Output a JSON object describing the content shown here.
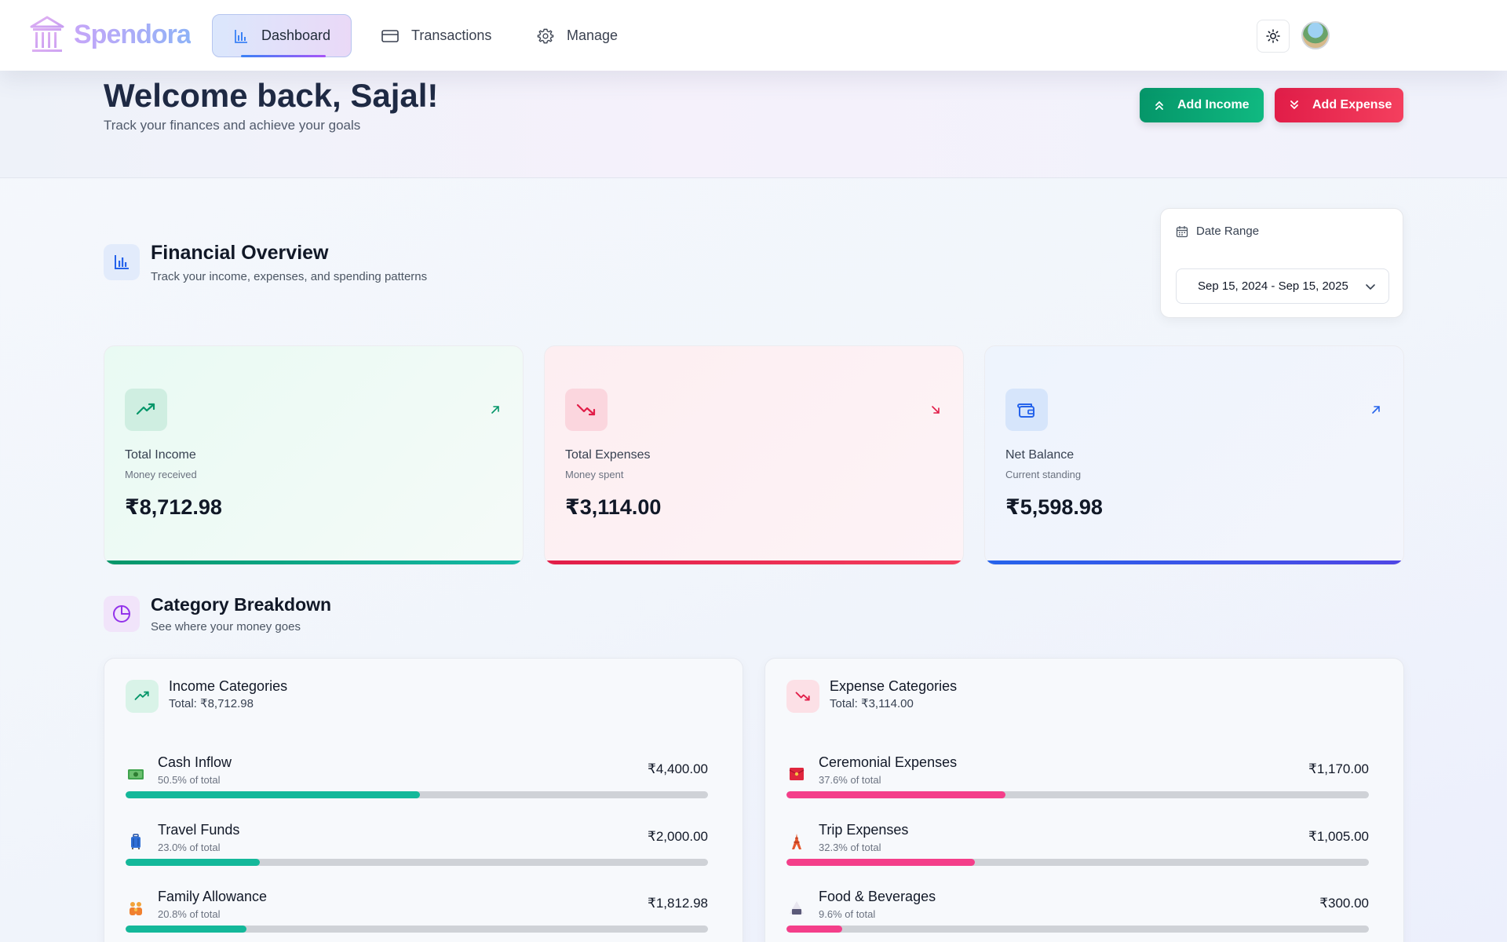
{
  "app": {
    "name": "Spendora"
  },
  "nav": {
    "items": [
      {
        "label": "Dashboard",
        "icon": "bar-chart-icon",
        "active": true
      },
      {
        "label": "Transactions",
        "icon": "credit-card-icon",
        "active": false
      },
      {
        "label": "Manage",
        "icon": "gear-icon",
        "active": false
      }
    ]
  },
  "hero": {
    "welcome": "Welcome back, Sajal!",
    "subtitle": "Track your finances and achieve your goals",
    "add_income": "Add Income",
    "add_expense": "Add Expense"
  },
  "overview": {
    "title": "Financial Overview",
    "subtitle": "Track your income, expenses, and spending patterns",
    "date_range_label": "Date Range",
    "date_range_value": "Sep 15, 2024 - Sep 15, 2025"
  },
  "stats": {
    "income": {
      "label": "Total Income",
      "sub": "Money received",
      "value": "₹8,712.98"
    },
    "expenses": {
      "label": "Total Expenses",
      "sub": "Money spent",
      "value": "₹3,114.00"
    },
    "balance": {
      "label": "Net Balance",
      "sub": "Current standing",
      "value": "₹5,598.98"
    }
  },
  "breakdown": {
    "title": "Category Breakdown",
    "subtitle": "See where your money goes",
    "income": {
      "title": "Income Categories",
      "total": "Total: ₹8,712.98",
      "items": [
        {
          "name": "Cash Inflow",
          "pct": "50.5% of total",
          "amount": "₹4,400.00",
          "fraction": 0.505,
          "icon": "dollar-banknote-icon"
        },
        {
          "name": "Travel Funds",
          "pct": "23.0% of total",
          "amount": "₹2,000.00",
          "fraction": 0.23,
          "icon": "suitcase-icon"
        },
        {
          "name": "Family Allowance",
          "pct": "20.8% of total",
          "amount": "₹1,812.98",
          "fraction": 0.208,
          "icon": "family-icon"
        }
      ]
    },
    "expense": {
      "title": "Expense Categories",
      "total": "Total: ₹3,114.00",
      "items": [
        {
          "name": "Ceremonial Expenses",
          "pct": "37.6% of total",
          "amount": "₹1,170.00",
          "fraction": 0.376,
          "icon": "red-envelope-icon"
        },
        {
          "name": "Trip Expenses",
          "pct": "32.3% of total",
          "amount": "₹1,005.00",
          "fraction": 0.323,
          "icon": "tower-icon"
        },
        {
          "name": "Food & Beverages",
          "pct": "9.6% of total",
          "amount": "₹300.00",
          "fraction": 0.096,
          "icon": "rice-ball-icon"
        }
      ]
    }
  },
  "colors": {
    "income_accent": "#059669",
    "expense_accent": "#e11d48",
    "balance_accent": "#2563eb",
    "income_bar": "#14b89a",
    "expense_bar": "#f43f8a"
  }
}
